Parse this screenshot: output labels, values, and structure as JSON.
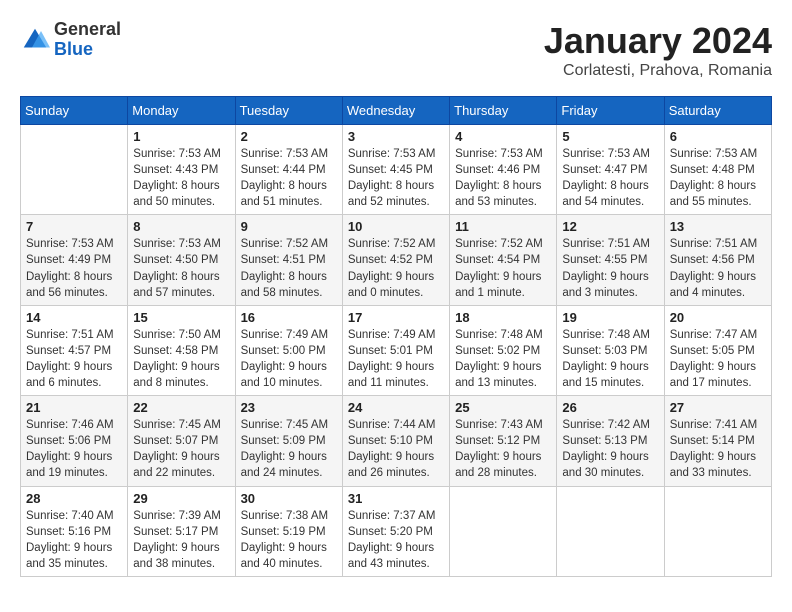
{
  "header": {
    "logo_general": "General",
    "logo_blue": "Blue",
    "month_title": "January 2024",
    "location": "Corlatesti, Prahova, Romania"
  },
  "days_of_week": [
    "Sunday",
    "Monday",
    "Tuesday",
    "Wednesday",
    "Thursday",
    "Friday",
    "Saturday"
  ],
  "weeks": [
    [
      {
        "num": "",
        "sunrise": "",
        "sunset": "",
        "daylight": ""
      },
      {
        "num": "1",
        "sunrise": "Sunrise: 7:53 AM",
        "sunset": "Sunset: 4:43 PM",
        "daylight": "Daylight: 8 hours and 50 minutes."
      },
      {
        "num": "2",
        "sunrise": "Sunrise: 7:53 AM",
        "sunset": "Sunset: 4:44 PM",
        "daylight": "Daylight: 8 hours and 51 minutes."
      },
      {
        "num": "3",
        "sunrise": "Sunrise: 7:53 AM",
        "sunset": "Sunset: 4:45 PM",
        "daylight": "Daylight: 8 hours and 52 minutes."
      },
      {
        "num": "4",
        "sunrise": "Sunrise: 7:53 AM",
        "sunset": "Sunset: 4:46 PM",
        "daylight": "Daylight: 8 hours and 53 minutes."
      },
      {
        "num": "5",
        "sunrise": "Sunrise: 7:53 AM",
        "sunset": "Sunset: 4:47 PM",
        "daylight": "Daylight: 8 hours and 54 minutes."
      },
      {
        "num": "6",
        "sunrise": "Sunrise: 7:53 AM",
        "sunset": "Sunset: 4:48 PM",
        "daylight": "Daylight: 8 hours and 55 minutes."
      }
    ],
    [
      {
        "num": "7",
        "sunrise": "Sunrise: 7:53 AM",
        "sunset": "Sunset: 4:49 PM",
        "daylight": "Daylight: 8 hours and 56 minutes."
      },
      {
        "num": "8",
        "sunrise": "Sunrise: 7:53 AM",
        "sunset": "Sunset: 4:50 PM",
        "daylight": "Daylight: 8 hours and 57 minutes."
      },
      {
        "num": "9",
        "sunrise": "Sunrise: 7:52 AM",
        "sunset": "Sunset: 4:51 PM",
        "daylight": "Daylight: 8 hours and 58 minutes."
      },
      {
        "num": "10",
        "sunrise": "Sunrise: 7:52 AM",
        "sunset": "Sunset: 4:52 PM",
        "daylight": "Daylight: 9 hours and 0 minutes."
      },
      {
        "num": "11",
        "sunrise": "Sunrise: 7:52 AM",
        "sunset": "Sunset: 4:54 PM",
        "daylight": "Daylight: 9 hours and 1 minute."
      },
      {
        "num": "12",
        "sunrise": "Sunrise: 7:51 AM",
        "sunset": "Sunset: 4:55 PM",
        "daylight": "Daylight: 9 hours and 3 minutes."
      },
      {
        "num": "13",
        "sunrise": "Sunrise: 7:51 AM",
        "sunset": "Sunset: 4:56 PM",
        "daylight": "Daylight: 9 hours and 4 minutes."
      }
    ],
    [
      {
        "num": "14",
        "sunrise": "Sunrise: 7:51 AM",
        "sunset": "Sunset: 4:57 PM",
        "daylight": "Daylight: 9 hours and 6 minutes."
      },
      {
        "num": "15",
        "sunrise": "Sunrise: 7:50 AM",
        "sunset": "Sunset: 4:58 PM",
        "daylight": "Daylight: 9 hours and 8 minutes."
      },
      {
        "num": "16",
        "sunrise": "Sunrise: 7:49 AM",
        "sunset": "Sunset: 5:00 PM",
        "daylight": "Daylight: 9 hours and 10 minutes."
      },
      {
        "num": "17",
        "sunrise": "Sunrise: 7:49 AM",
        "sunset": "Sunset: 5:01 PM",
        "daylight": "Daylight: 9 hours and 11 minutes."
      },
      {
        "num": "18",
        "sunrise": "Sunrise: 7:48 AM",
        "sunset": "Sunset: 5:02 PM",
        "daylight": "Daylight: 9 hours and 13 minutes."
      },
      {
        "num": "19",
        "sunrise": "Sunrise: 7:48 AM",
        "sunset": "Sunset: 5:03 PM",
        "daylight": "Daylight: 9 hours and 15 minutes."
      },
      {
        "num": "20",
        "sunrise": "Sunrise: 7:47 AM",
        "sunset": "Sunset: 5:05 PM",
        "daylight": "Daylight: 9 hours and 17 minutes."
      }
    ],
    [
      {
        "num": "21",
        "sunrise": "Sunrise: 7:46 AM",
        "sunset": "Sunset: 5:06 PM",
        "daylight": "Daylight: 9 hours and 19 minutes."
      },
      {
        "num": "22",
        "sunrise": "Sunrise: 7:45 AM",
        "sunset": "Sunset: 5:07 PM",
        "daylight": "Daylight: 9 hours and 22 minutes."
      },
      {
        "num": "23",
        "sunrise": "Sunrise: 7:45 AM",
        "sunset": "Sunset: 5:09 PM",
        "daylight": "Daylight: 9 hours and 24 minutes."
      },
      {
        "num": "24",
        "sunrise": "Sunrise: 7:44 AM",
        "sunset": "Sunset: 5:10 PM",
        "daylight": "Daylight: 9 hours and 26 minutes."
      },
      {
        "num": "25",
        "sunrise": "Sunrise: 7:43 AM",
        "sunset": "Sunset: 5:12 PM",
        "daylight": "Daylight: 9 hours and 28 minutes."
      },
      {
        "num": "26",
        "sunrise": "Sunrise: 7:42 AM",
        "sunset": "Sunset: 5:13 PM",
        "daylight": "Daylight: 9 hours and 30 minutes."
      },
      {
        "num": "27",
        "sunrise": "Sunrise: 7:41 AM",
        "sunset": "Sunset: 5:14 PM",
        "daylight": "Daylight: 9 hours and 33 minutes."
      }
    ],
    [
      {
        "num": "28",
        "sunrise": "Sunrise: 7:40 AM",
        "sunset": "Sunset: 5:16 PM",
        "daylight": "Daylight: 9 hours and 35 minutes."
      },
      {
        "num": "29",
        "sunrise": "Sunrise: 7:39 AM",
        "sunset": "Sunset: 5:17 PM",
        "daylight": "Daylight: 9 hours and 38 minutes."
      },
      {
        "num": "30",
        "sunrise": "Sunrise: 7:38 AM",
        "sunset": "Sunset: 5:19 PM",
        "daylight": "Daylight: 9 hours and 40 minutes."
      },
      {
        "num": "31",
        "sunrise": "Sunrise: 7:37 AM",
        "sunset": "Sunset: 5:20 PM",
        "daylight": "Daylight: 9 hours and 43 minutes."
      },
      {
        "num": "",
        "sunrise": "",
        "sunset": "",
        "daylight": ""
      },
      {
        "num": "",
        "sunrise": "",
        "sunset": "",
        "daylight": ""
      },
      {
        "num": "",
        "sunrise": "",
        "sunset": "",
        "daylight": ""
      }
    ]
  ]
}
